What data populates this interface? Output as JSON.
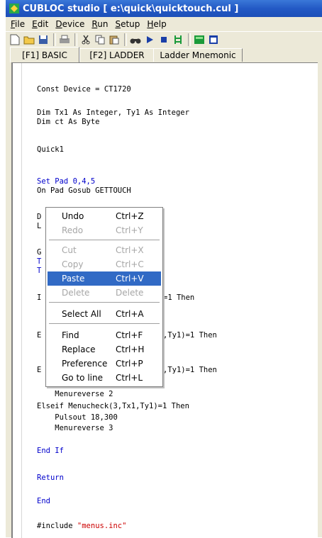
{
  "window": {
    "title": "CUBLOC studio [ e:\\quick\\quicktouch.cul ]"
  },
  "menubar": [
    {
      "ul": "F",
      "rest": "ile"
    },
    {
      "ul": "E",
      "rest": "dit"
    },
    {
      "ul": "D",
      "rest": "evice"
    },
    {
      "ul": "R",
      "rest": "un"
    },
    {
      "ul": "S",
      "rest": "etup"
    },
    {
      "ul": "H",
      "rest": "elp"
    }
  ],
  "toolbar_icons": [
    "new-file-icon",
    "open-folder-icon",
    "save-icon",
    "print-icon",
    "cut-icon",
    "copy-icon",
    "paste-icon",
    "find-icon",
    "run-icon",
    "stop-icon",
    "ladder-icon",
    "monitor-icon",
    "window-icon"
  ],
  "tabs": {
    "basic": "[F1] BASIC",
    "ladder": "[F2] LADDER",
    "mnemonic": "Ladder Mnemonic"
  },
  "code": {
    "l1a": "Const Device = CT1720",
    "l2a": "Dim Tx1 As Integer, Ty1 As Integer",
    "l3a": "Dim ct As Byte",
    "l4a": "Quick1",
    "l5a": "Set Pad 0,4,5",
    "l6a": "On Pad Gosub GETTOUCH",
    "f1": "D",
    "f2": "L",
    "f3": "G",
    "f4": "T",
    "f5": "T",
    "f6": "I",
    "f6r": "=1 Then",
    "f7": "E",
    "f7r": ",Ty1)=1 Then",
    "f8": "E",
    "f8r": ",Ty1)=1 Then",
    "l9": "    Menureverse 2",
    "l10": "Elseif Menucheck(3,Tx1,Ty1)=1 Then",
    "l11": "    Pulsout 18,300",
    "l12": "    Menureverse 3",
    "l13": "End If",
    "l14": "Return",
    "l15": "End",
    "l16a": "#include ",
    "l16b": "\"menus.inc\""
  },
  "context_menu": {
    "undo": {
      "label": "Undo",
      "shortcut": "Ctrl+Z"
    },
    "redo": {
      "label": "Redo",
      "shortcut": "Ctrl+Y"
    },
    "cut": {
      "label": "Cut",
      "shortcut": "Ctrl+X"
    },
    "copy": {
      "label": "Copy",
      "shortcut": "Ctrl+C"
    },
    "paste": {
      "label": "Paste",
      "shortcut": "Ctrl+V"
    },
    "delete": {
      "label": "Delete",
      "shortcut": "Delete"
    },
    "select_all": {
      "label": "Select All",
      "shortcut": "Ctrl+A"
    },
    "find": {
      "label": "Find",
      "shortcut": "Ctrl+F"
    },
    "replace": {
      "label": "Replace",
      "shortcut": "Ctrl+H"
    },
    "preference": {
      "label": "Preference",
      "shortcut": "Ctrl+P"
    },
    "goto": {
      "label": "Go to line",
      "shortcut": "Ctrl+L"
    }
  },
  "colors": {
    "titlebar": "#2359c5",
    "keyword": "#0000cc",
    "string": "#cc0000",
    "highlight": "#316ac5"
  }
}
